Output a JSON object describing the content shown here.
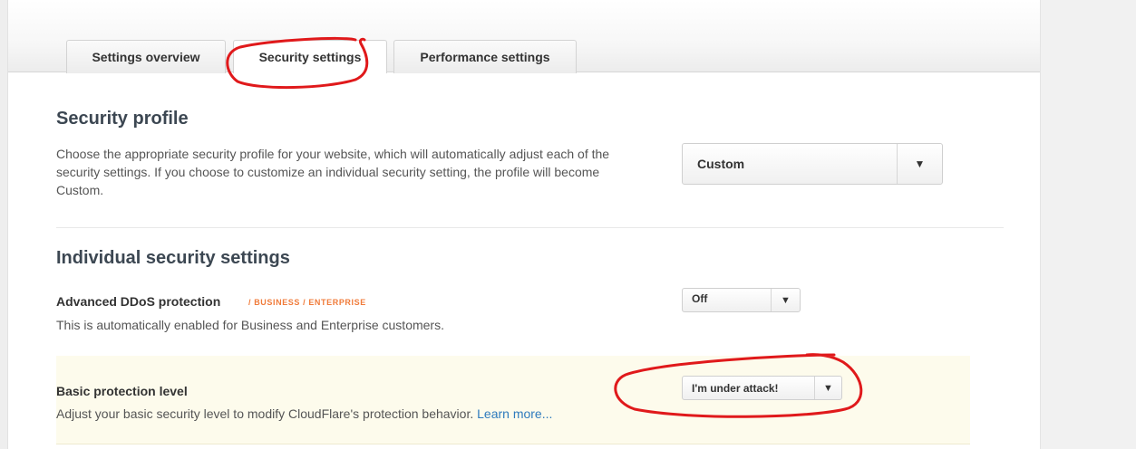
{
  "tabs": [
    {
      "label": "Settings overview",
      "active": false
    },
    {
      "label": "Security settings",
      "active": true
    },
    {
      "label": "Performance settings",
      "active": false
    }
  ],
  "security_profile": {
    "heading": "Security profile",
    "description": "Choose the appropriate security profile for your website, which will automatically adjust each of the security settings. If you choose to customize an individual security setting, the profile will become Custom.",
    "select_value": "Custom"
  },
  "individual": {
    "heading": "Individual security settings",
    "ddos": {
      "title": "Advanced DDoS protection",
      "plan_tag": "/ BUSINESS / ENTERPRISE",
      "description": "This is automatically enabled for Business and Enterprise customers.",
      "select_value": "Off"
    },
    "basic_level": {
      "title": "Basic protection level",
      "description": "Adjust your basic security level to modify CloudFlare's protection behavior.",
      "link": "Learn more...",
      "select_value": "I'm under attack!"
    }
  },
  "icons": {
    "dropdown_arrow": "▼"
  },
  "colors": {
    "annotation_red": "#e0191b",
    "plan_tag": "#f07b3a",
    "link": "#2f7bbd",
    "highlight_row": "#fdfbec"
  }
}
